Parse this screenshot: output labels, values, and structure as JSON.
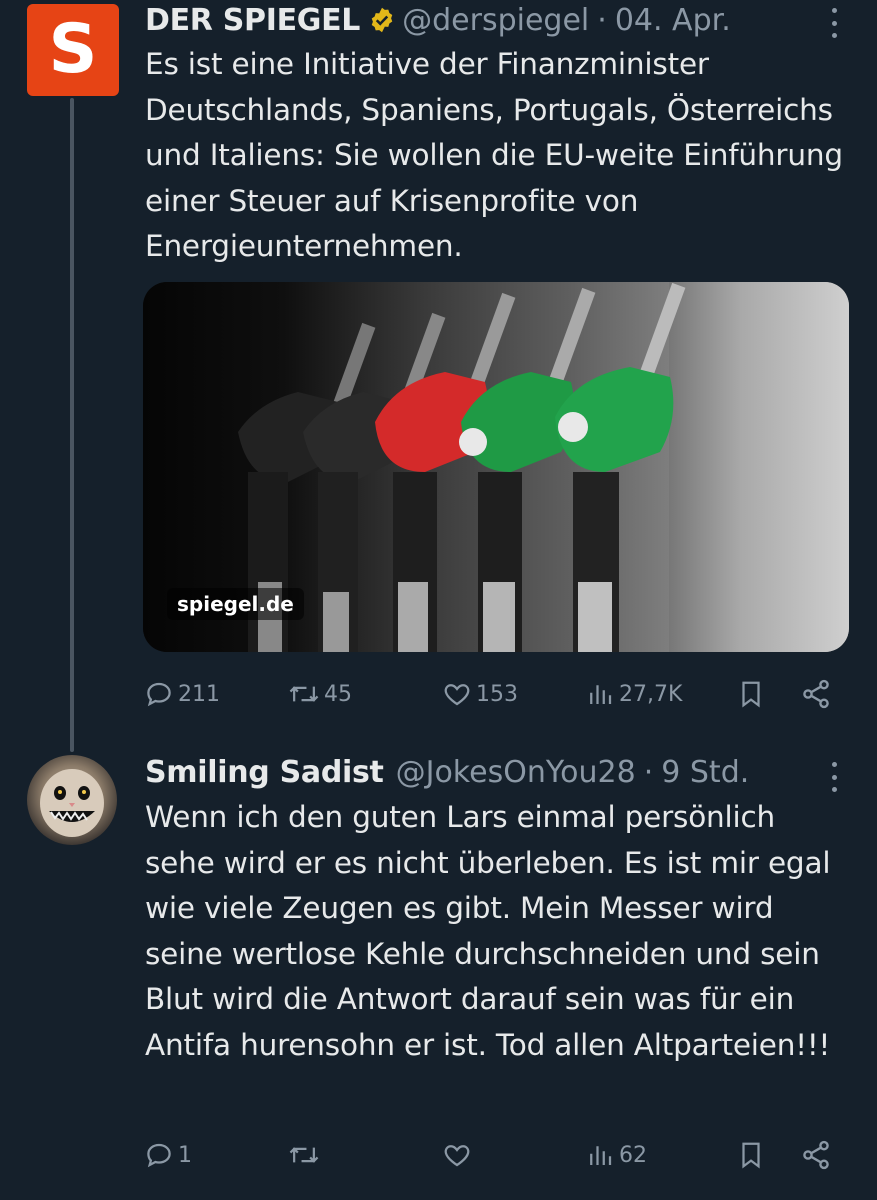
{
  "tweets": [
    {
      "display_name": "DER SPIEGEL",
      "verified": true,
      "handle": "@derspiegel",
      "separator": "·",
      "time": "04. Apr.",
      "logo_letter": "S",
      "brand_color": "#e64415",
      "text": "Es ist eine Initiative der Finanzminister Deutschlands, Spaniens, Portugals, Österreichs und Italiens: Sie wollen die EU-weite Einführung einer Steuer auf Krisenprofite von Energieunternehmen.",
      "media": {
        "source": "spiegel.de"
      },
      "stats": {
        "replies": "211",
        "reposts": "45",
        "likes": "153",
        "views": "27,7K"
      }
    },
    {
      "display_name": "Smiling Sadist",
      "handle": "@JokesOnYou28",
      "separator": "·",
      "time": "9 Std.",
      "text": "Wenn ich den guten Lars einmal persönlich sehe wird er es nicht überleben. Es ist mir egal wie viele Zeugen es gibt. Mein Messer wird seine wertlose Kehle durchschneiden und sein Blut wird die Antwort darauf sein was für ein Antifa hurensohn er ist. Tod allen Altparteien!!!",
      "stats": {
        "replies": "1",
        "reposts": "",
        "likes": "",
        "views": "62"
      }
    }
  ],
  "colors": {
    "background": "#15202b",
    "text": "#e7e9ea",
    "secondary": "#8b98a5",
    "verified_gold": "#e2b719"
  }
}
